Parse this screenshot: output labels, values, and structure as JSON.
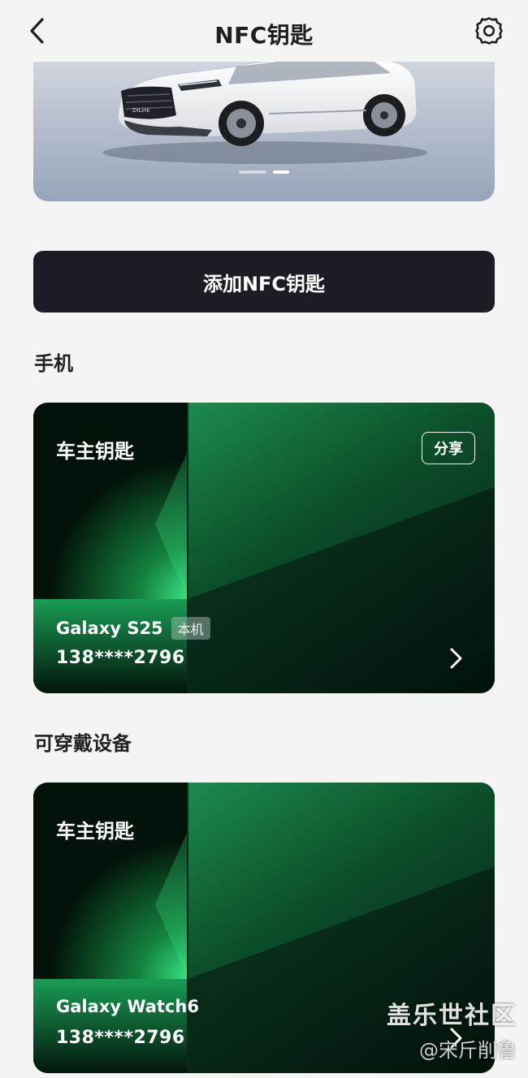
{
  "header": {
    "title": "NFC钥匙",
    "back_icon": "chevron-left-icon",
    "settings_icon": "gear-icon"
  },
  "banner": {
    "image": "white BYD SUV car photo",
    "car_badge": "DiLink",
    "carousel_pages": 2,
    "active_page": 2
  },
  "add_button": {
    "label": "添加NFC钥匙"
  },
  "sections": [
    {
      "title": "手机",
      "card": {
        "title": "车主钥匙",
        "share_label": "分享",
        "device_name": "Galaxy S25",
        "badge": "本机",
        "phone": "138****2796"
      }
    },
    {
      "title": "可穿戴设备",
      "card": {
        "title": "车主钥匙",
        "device_name": "Galaxy Watch6",
        "phone": "138****2796"
      }
    }
  ],
  "watermark": {
    "site": "盖乐世社区",
    "user": "@宋斤削鲁"
  },
  "colors": {
    "background": "#f4f4f4",
    "button_dark": "#1c1c24",
    "card_green": "#1fae5a"
  }
}
